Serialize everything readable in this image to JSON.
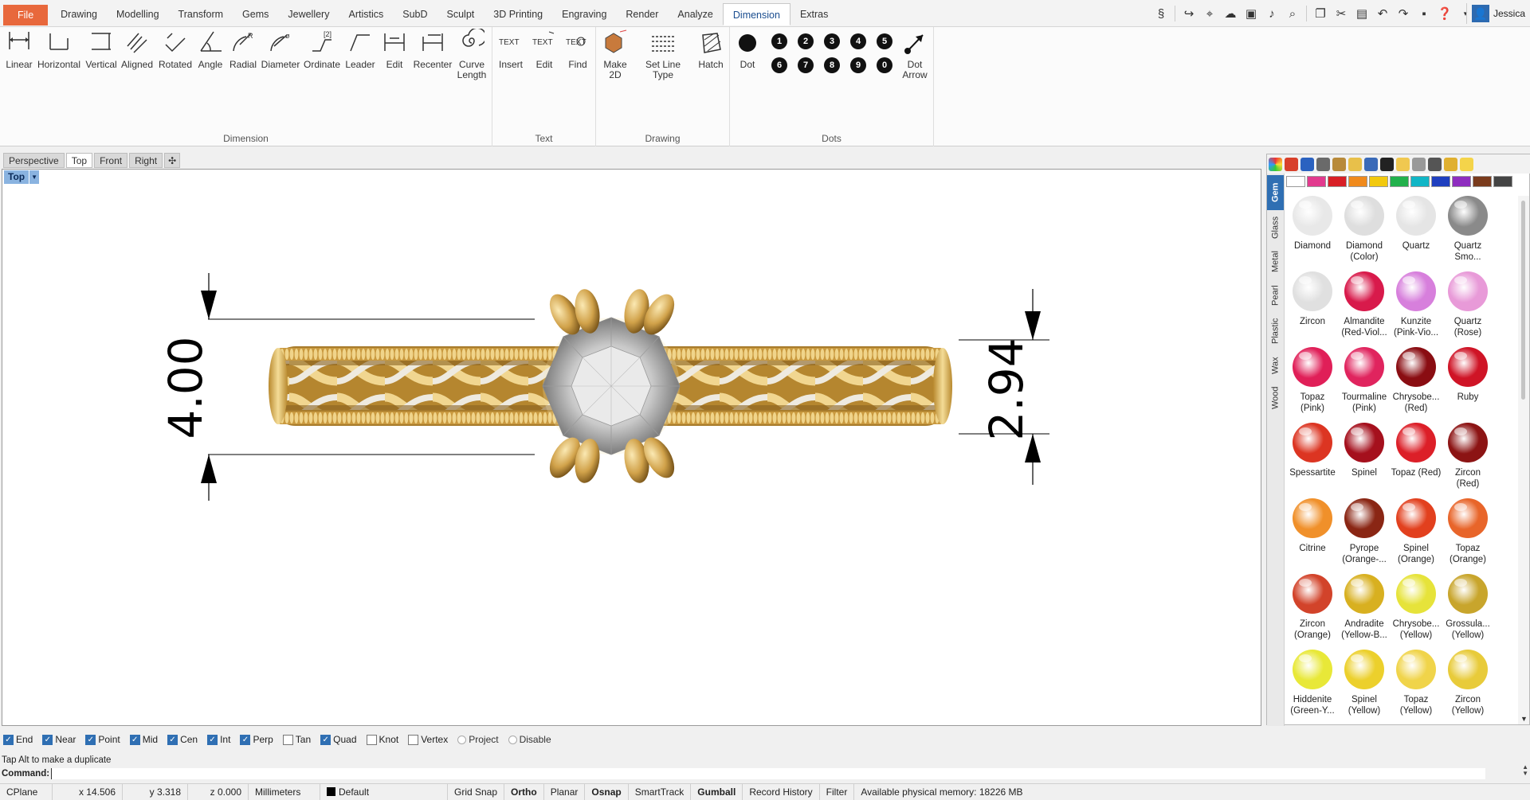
{
  "menu": {
    "tabs": [
      "File",
      "Drawing",
      "Modelling",
      "Transform",
      "Gems",
      "Jewellery",
      "Artistics",
      "SubD",
      "Sculpt",
      "3D Printing",
      "Engraving",
      "Render",
      "Analyze",
      "Dimension",
      "Extras"
    ],
    "active": "Dimension",
    "user": "Jessica"
  },
  "ribbon": {
    "dimension": {
      "title": "Dimension",
      "buttons": [
        "Linear",
        "Horizontal",
        "Vertical",
        "Aligned",
        "Rotated",
        "Angle",
        "Radial",
        "Diameter",
        "Ordinate",
        "Leader",
        "Edit",
        "Recenter",
        "Curve\nLength"
      ]
    },
    "text": {
      "title": "Text",
      "buttons": [
        "Insert",
        "Edit",
        "Find"
      ],
      "icon_text": "TEXT"
    },
    "drawing": {
      "title": "Drawing",
      "buttons": [
        "Make\n2D",
        "Set Line Type",
        "Hatch"
      ]
    },
    "dots": {
      "title": "Dots",
      "dot_label": "Dot",
      "arrow_label": "Dot\nArrow",
      "numbers": [
        "1",
        "2",
        "3",
        "4",
        "5",
        "6",
        "7",
        "8",
        "9",
        "0"
      ]
    }
  },
  "viewport_tabs": [
    "Perspective",
    "Top",
    "Front",
    "Right"
  ],
  "active_viewport_tab": "Top",
  "viewport": {
    "label": "Top",
    "dim_left": "4.00",
    "dim_right": "2.94",
    "colors": {
      "gold": "#d4a94f",
      "diamond": "#d9d9d9"
    }
  },
  "panel": {
    "vertical_tabs": [
      "Gem",
      "Glass",
      "Metal",
      "Pearl",
      "Plastic",
      "Wax",
      "Wood"
    ],
    "active_tab": "Gem",
    "swatch_colors": [
      "#ffffff",
      "#e23a8e",
      "#d81f26",
      "#f08a1c",
      "#f2c90e",
      "#22b14c",
      "#11b6c6",
      "#1f3fbf",
      "#8e2dbf",
      "#7a3b1c",
      "#444444"
    ],
    "gems": [
      {
        "name": "Diamond",
        "sub": "",
        "color": "#e8e8e8"
      },
      {
        "name": "Diamond",
        "sub": "(Color)",
        "color": "#dedede"
      },
      {
        "name": "Quartz",
        "sub": "",
        "color": "#e5e5e5"
      },
      {
        "name": "Quartz",
        "sub": "Smo...",
        "color": "#8a8a8a"
      },
      {
        "name": "Zircon",
        "sub": "",
        "color": "#e0e0e0"
      },
      {
        "name": "Almandite",
        "sub": "(Red-Viol...",
        "color": "#d81a4b"
      },
      {
        "name": "Kunzite",
        "sub": "(Pink-Vio...",
        "color": "#d77fdc"
      },
      {
        "name": "Quartz",
        "sub": "(Rose)",
        "color": "#e89ad8"
      },
      {
        "name": "Topaz",
        "sub": "(Pink)",
        "color": "#e01f58"
      },
      {
        "name": "Tourmaline",
        "sub": "(Pink)",
        "color": "#e0245e"
      },
      {
        "name": "Chrysobe...",
        "sub": "(Red)",
        "color": "#8a0d12"
      },
      {
        "name": "Ruby",
        "sub": "",
        "color": "#cf1426"
      },
      {
        "name": "Spessartite",
        "sub": "",
        "color": "#dc3522"
      },
      {
        "name": "Spinel",
        "sub": "",
        "color": "#a5101d"
      },
      {
        "name": "Topaz (Red)",
        "sub": "",
        "color": "#dc1f28"
      },
      {
        "name": "Zircon",
        "sub": "(Red)",
        "color": "#8c1414"
      },
      {
        "name": "Citrine",
        "sub": "",
        "color": "#f0902a"
      },
      {
        "name": "Pyrope",
        "sub": "(Orange-...",
        "color": "#8a2614"
      },
      {
        "name": "Spinel",
        "sub": "(Orange)",
        "color": "#e2401e"
      },
      {
        "name": "Topaz",
        "sub": "(Orange)",
        "color": "#e8652a"
      },
      {
        "name": "Zircon",
        "sub": "(Orange)",
        "color": "#d2432a"
      },
      {
        "name": "Andradite",
        "sub": "(Yellow-B...",
        "color": "#d8b020"
      },
      {
        "name": "Chrysobe...",
        "sub": "(Yellow)",
        "color": "#e6e33a"
      },
      {
        "name": "Grossula...",
        "sub": "(Yellow)",
        "color": "#c8a52c"
      },
      {
        "name": "Hiddenite",
        "sub": "(Green-Y...",
        "color": "#e8e838"
      },
      {
        "name": "Spinel",
        "sub": "(Yellow)",
        "color": "#ecd02c"
      },
      {
        "name": "Topaz",
        "sub": "(Yellow)",
        "color": "#f0d44a"
      },
      {
        "name": "Zircon",
        "sub": "(Yellow)",
        "color": "#e8cb3a"
      }
    ]
  },
  "osnap": [
    {
      "label": "End",
      "on": true
    },
    {
      "label": "Near",
      "on": true
    },
    {
      "label": "Point",
      "on": true
    },
    {
      "label": "Mid",
      "on": true
    },
    {
      "label": "Cen",
      "on": true
    },
    {
      "label": "Int",
      "on": true
    },
    {
      "label": "Perp",
      "on": true
    },
    {
      "label": "Tan",
      "on": false
    },
    {
      "label": "Quad",
      "on": true
    },
    {
      "label": "Knot",
      "on": false
    },
    {
      "label": "Vertex",
      "on": false
    }
  ],
  "osnap_radio": [
    "Project",
    "Disable"
  ],
  "command": {
    "history": "Tap Alt to make a duplicate",
    "prompt": "Command:"
  },
  "status": {
    "cplane": "CPlane",
    "x": "x 14.506",
    "y": "y 3.318",
    "z": "z 0.000",
    "units": "Millimeters",
    "layer": "Default",
    "toggles": [
      {
        "label": "Grid Snap",
        "bold": false
      },
      {
        "label": "Ortho",
        "bold": true
      },
      {
        "label": "Planar",
        "bold": false
      },
      {
        "label": "Osnap",
        "bold": true
      },
      {
        "label": "SmartTrack",
        "bold": false
      },
      {
        "label": "Gumball",
        "bold": true
      },
      {
        "label": "Record History",
        "bold": false
      },
      {
        "label": "Filter",
        "bold": false
      }
    ],
    "memory": "Available physical memory: 18226 MB"
  }
}
